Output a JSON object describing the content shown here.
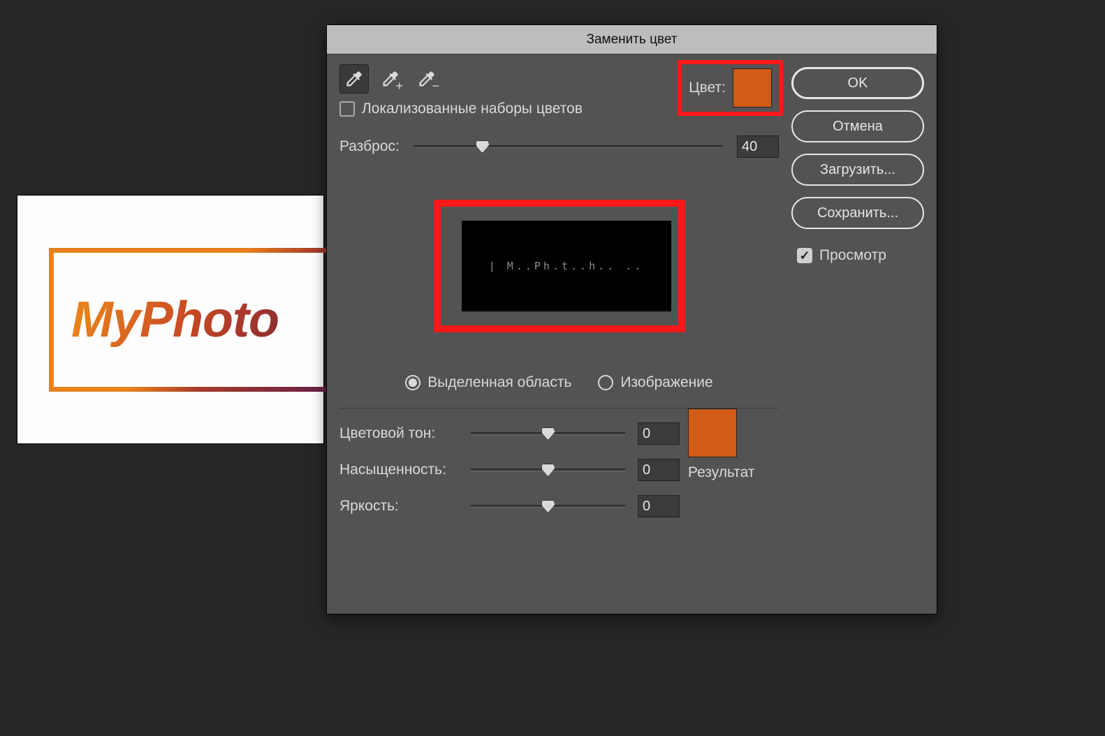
{
  "canvas": {
    "logo_text": "MyPhoto"
  },
  "dialog": {
    "title": "Заменить цвет",
    "localized_sets_label": "Локализованные наборы цветов",
    "color_label": "Цвет:",
    "color_swatch": "#d15b17",
    "fuzziness_label": "Разброс:",
    "fuzziness_value": "40",
    "fuzziness_percent": 20,
    "preview_text": "| M..Ph.t..h.. ..",
    "radio_selection": "Выделенная область",
    "radio_image": "Изображение",
    "hue_label": "Цветовой тон:",
    "hue_value": "0",
    "sat_label": "Насыщенность:",
    "sat_value": "0",
    "light_label": "Яркость:",
    "light_value": "0",
    "result_label": "Результат",
    "result_swatch": "#d15b17"
  },
  "buttons": {
    "ok": "OK",
    "cancel": "Отмена",
    "load": "Загрузить...",
    "save": "Сохранить...",
    "preview": "Просмотр"
  }
}
